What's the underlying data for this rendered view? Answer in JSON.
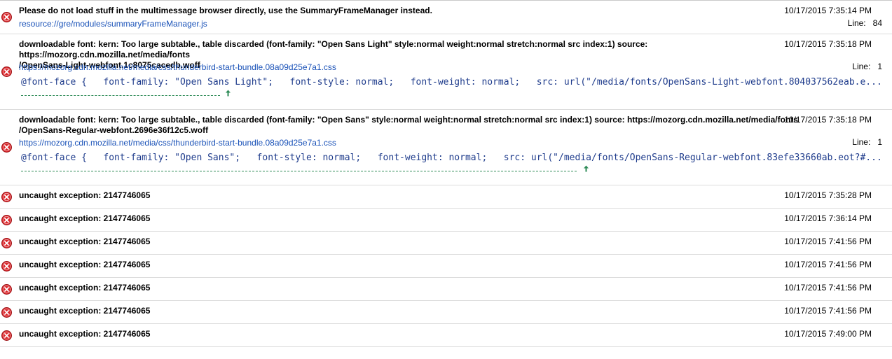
{
  "console": {
    "rows": [
      {
        "severity": "error",
        "icon": "error-icon",
        "message": "Please do not load stuff in the multimessage browser directly, use the SummaryFrameManager instead.",
        "timestamp": "10/17/2015 7:35:14 PM",
        "source": "resource://gre/modules/summaryFrameManager.js",
        "line_label": "Line:",
        "line_number": "84"
      },
      {
        "severity": "error",
        "icon": "error-icon",
        "message": "downloadable font: kern: Too large subtable., table discarded (font-family: \"Open Sans Light\" style:normal weight:normal stretch:normal src index:1) source: https://mozorg.cdn.mozilla.net/media/fonts\n/OpenSans-Light-webfont.1c8075cacedb.woff",
        "timestamp": "10/17/2015 7:35:18 PM",
        "source": "https://mozorg.cdn.mozilla.net/media/css/thunderbird-start-bundle.08a09d25e7a1.css",
        "line_label": "Line:",
        "line_number": "1",
        "code": "@font-face {   font-family: \"Open Sans Light\";   font-style: normal;   font-weight: normal;   src: url(\"/media/fonts/OpenSans-Light-webfont.804037562eab.e..."
      },
      {
        "severity": "error",
        "icon": "error-icon",
        "message": "downloadable font: kern: Too large subtable., table discarded (font-family: \"Open Sans\" style:normal weight:normal stretch:normal src index:1) source: https://mozorg.cdn.mozilla.net/media/fonts\n/OpenSans-Regular-webfont.2696e36f12c5.woff",
        "timestamp": "10/17/2015 7:35:18 PM",
        "source": "https://mozorg.cdn.mozilla.net/media/css/thunderbird-start-bundle.08a09d25e7a1.css",
        "line_label": "Line:",
        "line_number": "1",
        "code": "@font-face {   font-family: \"Open Sans\";   font-style: normal;   font-weight: normal;   src: url(\"/media/fonts/OpenSans-Regular-webfont.83efe33660ab.eot?#..."
      },
      {
        "severity": "error",
        "icon": "error-icon",
        "message": "uncaught exception: 2147746065",
        "timestamp": "10/17/2015 7:35:28 PM"
      },
      {
        "severity": "error",
        "icon": "error-icon",
        "message": "uncaught exception: 2147746065",
        "timestamp": "10/17/2015 7:36:14 PM"
      },
      {
        "severity": "error",
        "icon": "error-icon",
        "message": "uncaught exception: 2147746065",
        "timestamp": "10/17/2015 7:41:56 PM"
      },
      {
        "severity": "error",
        "icon": "error-icon",
        "message": "uncaught exception: 2147746065",
        "timestamp": "10/17/2015 7:41:56 PM"
      },
      {
        "severity": "error",
        "icon": "error-icon",
        "message": "uncaught exception: 2147746065",
        "timestamp": "10/17/2015 7:41:56 PM"
      },
      {
        "severity": "error",
        "icon": "error-icon",
        "message": "uncaught exception: 2147746065",
        "timestamp": "10/17/2015 7:41:56 PM"
      },
      {
        "severity": "error",
        "icon": "error-icon",
        "message": "uncaught exception: 2147746065",
        "timestamp": "10/17/2015 7:49:00 PM"
      }
    ]
  },
  "colors": {
    "error_icon": "#d9262b",
    "link": "#1a52b8",
    "code": "#1f3c8c",
    "code_caret": "#2e8b57",
    "row_border": "#dcdcdc"
  }
}
